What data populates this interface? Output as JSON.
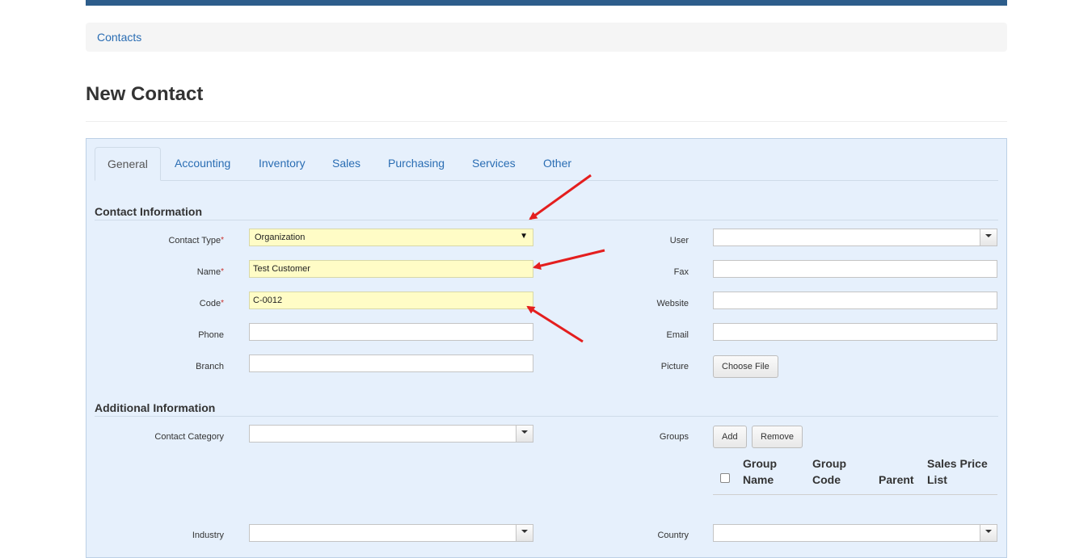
{
  "breadcrumb": {
    "contacts": "Contacts"
  },
  "page": {
    "title": "New Contact"
  },
  "tabs": [
    {
      "label": "General"
    },
    {
      "label": "Accounting"
    },
    {
      "label": "Inventory"
    },
    {
      "label": "Sales"
    },
    {
      "label": "Purchasing"
    },
    {
      "label": "Services"
    },
    {
      "label": "Other"
    }
  ],
  "contact_info": {
    "title": "Contact Information",
    "contact_type": {
      "label": "Contact Type",
      "value": "Organization"
    },
    "name": {
      "label": "Name",
      "value": "Test Customer"
    },
    "code": {
      "label": "Code",
      "value": "C-0012"
    },
    "phone": {
      "label": "Phone",
      "value": ""
    },
    "branch": {
      "label": "Branch",
      "value": ""
    },
    "user": {
      "label": "User",
      "value": ""
    },
    "fax": {
      "label": "Fax",
      "value": ""
    },
    "website": {
      "label": "Website",
      "value": ""
    },
    "email": {
      "label": "Email",
      "value": ""
    },
    "picture": {
      "label": "Picture",
      "button": "Choose File"
    }
  },
  "additional_info": {
    "title": "Additional Information",
    "contact_category": {
      "label": "Contact Category",
      "value": ""
    },
    "groups": {
      "label": "Groups",
      "add_label": "Add",
      "remove_label": "Remove",
      "columns": [
        "Group\nName",
        "Group\nCode",
        "Parent",
        "Sales Price\nList"
      ]
    },
    "industry": {
      "label": "Industry",
      "value": ""
    },
    "country": {
      "label": "Country",
      "value": ""
    }
  },
  "required_mark": "*",
  "colors": {
    "annotation_arrow": "#e41e1e",
    "link": "#2a6db3",
    "highlight_field": "#fffcc6"
  }
}
